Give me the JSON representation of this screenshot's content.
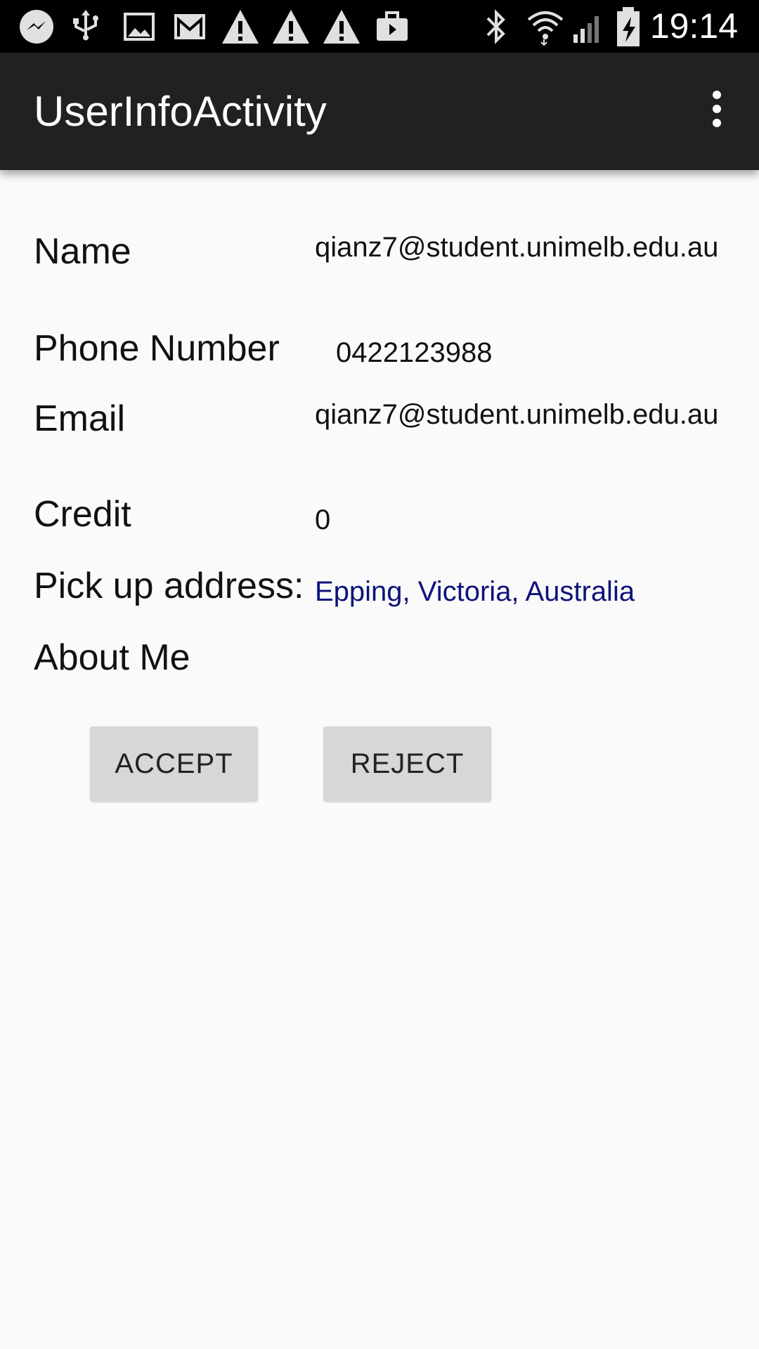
{
  "status_bar": {
    "time": "19:14",
    "icons_left": [
      "messenger-icon",
      "usb-icon",
      "image-icon",
      "gmail-icon",
      "warning-icon",
      "warning-icon",
      "warning-icon",
      "briefcase-icon"
    ],
    "icons_right": [
      "bluetooth-icon",
      "wifi-icon",
      "signal-icon",
      "battery-charging-icon"
    ]
  },
  "app_bar": {
    "title": "UserInfoActivity",
    "overflow_icon": "more-vert-icon"
  },
  "user_info": {
    "name_label": "Name",
    "name_value": "qianz7@student.unimelb.edu.au",
    "phone_label": "Phone Number",
    "phone_value": "0422123988",
    "email_label": "Email",
    "email_value": "qianz7@student.unimelb.edu.au",
    "credit_label": "Credit",
    "credit_value": "0",
    "address_label": "Pick up address:",
    "address_value": "Epping, Victoria, Australia",
    "about_label": "About Me"
  },
  "actions": {
    "accept_label": "ACCEPT",
    "reject_label": "REJECT"
  },
  "colors": {
    "app_bar": "#212121",
    "background": "#fafafa",
    "link": "#0d137a",
    "button": "#d6d7d7"
  }
}
